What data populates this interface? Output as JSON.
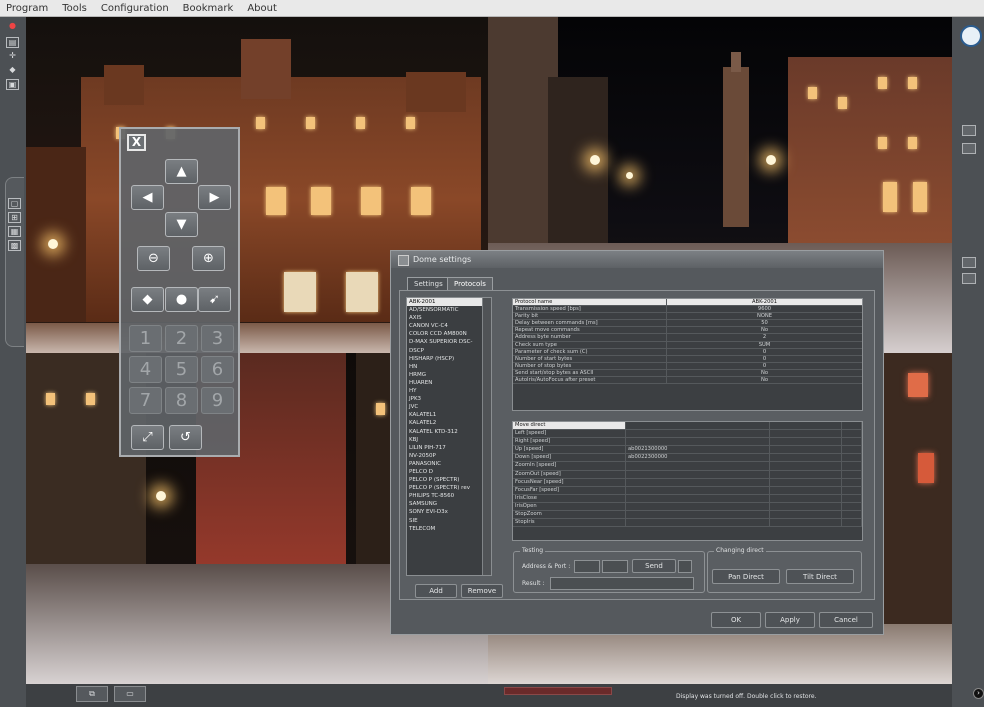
{
  "menu": [
    "Program",
    "Tools",
    "Configuration",
    "Bookmark",
    "About"
  ],
  "ptz": {
    "close_label": "X",
    "arrows": {
      "up": "▲",
      "left": "◀",
      "right": "▶",
      "down": "▼"
    },
    "numbers": [
      "1",
      "2",
      "3",
      "4",
      "5",
      "6",
      "7",
      "8",
      "9"
    ]
  },
  "dialog": {
    "title": "Dome settings",
    "tabs": [
      "Settings",
      "Protocols"
    ],
    "protocols": [
      "ABK-2001",
      "AD/SENSORMATIC",
      "AXIS",
      "CANON VC-C4",
      "COLOR CCD AM800N",
      "D-MAX SUPERIOR DSC-",
      "DSCP",
      "HISHARP (HSCP)",
      "HN",
      "HRMG",
      "HUAREN",
      "HY",
      "JPK3",
      "JVC",
      "KALATEL1",
      "KALATEL2",
      "KALATEL KTD-312",
      "KBJ",
      "LILIN PIH-717",
      "NV-2050P",
      "PANASONIC",
      "PELCO D",
      "PELCO P (SPECTR)",
      "PELCO P (SPECTR) rev",
      "PHILIPS TC-8560",
      "SAMSUNG",
      "SONY EVI-D3x",
      "SIE",
      "TELECOM"
    ],
    "add_label": "Add",
    "remove_label": "Remove",
    "params_header": {
      "name": "Protocol name",
      "value": "ABK-2001"
    },
    "params": [
      {
        "name": "Transmission speed [bps]",
        "value": "9600"
      },
      {
        "name": "Parity bit",
        "value": "NONE"
      },
      {
        "name": "Delay between commands [ms]",
        "value": "50"
      },
      {
        "name": "Repeat move commands",
        "value": "No"
      },
      {
        "name": "Address byte number",
        "value": "2"
      },
      {
        "name": "Check sum type",
        "value": "SUM"
      },
      {
        "name": "Parameter of check sum (C)",
        "value": "0"
      },
      {
        "name": "Number of start bytes",
        "value": "0"
      },
      {
        "name": "Number of stop bytes",
        "value": "0"
      },
      {
        "name": "Send start/stop bytes as ASCII",
        "value": "No"
      },
      {
        "name": "AutoIris/AutoFocus after preset",
        "value": "No"
      }
    ],
    "commands": [
      {
        "name": "Move direct",
        "code": ""
      },
      {
        "name": "Left [speed]",
        "code": ""
      },
      {
        "name": "Right [speed]",
        "code": ""
      },
      {
        "name": "Up [speed]",
        "code": "ab0021300000"
      },
      {
        "name": "Down [speed]",
        "code": "ab0022300000"
      },
      {
        "name": "ZoomIn [speed]",
        "code": ""
      },
      {
        "name": "ZoomOut [speed]",
        "code": ""
      },
      {
        "name": "FocusNear [speed]",
        "code": ""
      },
      {
        "name": "FocusFar [speed]",
        "code": ""
      },
      {
        "name": "IrisClose",
        "code": ""
      },
      {
        "name": "IrisOpen",
        "code": ""
      },
      {
        "name": "StopZoom",
        "code": ""
      },
      {
        "name": "StopIris",
        "code": ""
      }
    ],
    "testing_title": "Testing",
    "address_label": "Address & Port :",
    "send_label": "Send",
    "result_label": "Result :",
    "changing_title": "Changing direct",
    "pan_label": "Pan Direct",
    "tilt_label": "Tilt Direct",
    "ok_label": "OK",
    "apply_label": "Apply",
    "cancel_label": "Cancel"
  },
  "status_text": "Display was turned off. Double click to restore."
}
